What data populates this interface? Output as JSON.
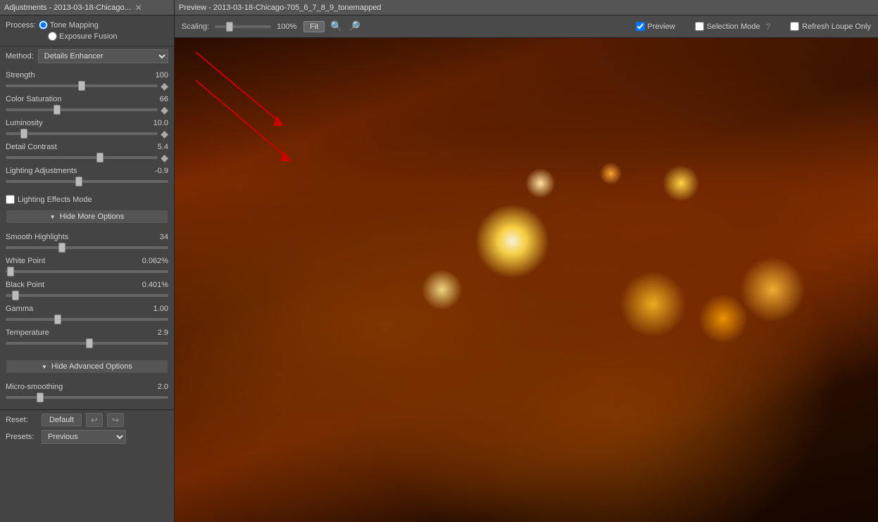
{
  "leftTitle": "Adjustments - 2013-03-18-Chicago...",
  "rightTitle": "Preview - 2013-03-18-Chicago-705_6_7_8_9_tonemapped",
  "process": {
    "label": "Process:",
    "toneMapping": "Tone Mapping",
    "exposureFusion": "Exposure Fusion"
  },
  "method": {
    "label": "Method:",
    "value": "Details Enhancer"
  },
  "scaling": {
    "label": "Scaling:",
    "value": 100,
    "unit": "%"
  },
  "fitButton": "Fit",
  "previewCheck": "Preview",
  "selectionMode": "Selection Mode",
  "refreshLoupeOnly": "Refresh Loupe Only",
  "sliders": {
    "strength": {
      "label": "Strength",
      "value": "100",
      "min": 0,
      "max": 200,
      "current": 100
    },
    "colorSaturation": {
      "label": "Color Saturation",
      "value": "66",
      "min": 0,
      "max": 200,
      "current": 66
    },
    "luminosity": {
      "label": "Luminosity",
      "value": "10.0",
      "min": 0,
      "max": 100,
      "current": 10
    },
    "detailContrast": {
      "label": "Detail Contrast",
      "value": "5.4",
      "min": -20,
      "max": 20,
      "current": 5.4
    },
    "lightingAdjustments": {
      "label": "Lighting Adjustments",
      "value": "-0.9",
      "min": -10,
      "max": 10,
      "current": -0.9
    }
  },
  "lightingEffectsMode": "Lighting Effects Mode",
  "hideMoreOptions": "Hide More Options",
  "moreSliders": {
    "smoothHighlights": {
      "label": "Smooth Highlights",
      "value": "34",
      "min": 0,
      "max": 100,
      "current": 34
    },
    "whitePoint": {
      "label": "White Point",
      "value": "0.062%",
      "min": 0,
      "max": 10,
      "current": 0.062
    },
    "blackPoint": {
      "label": "Black Point",
      "value": "0.401%",
      "min": 0,
      "max": 10,
      "current": 0.401
    },
    "gamma": {
      "label": "Gamma",
      "value": "1.00",
      "min": 0.1,
      "max": 3,
      "current": 1.0
    },
    "temperature": {
      "label": "Temperature",
      "value": "2.9",
      "min": -100,
      "max": 100,
      "current": 2.9
    }
  },
  "hideAdvancedOptions": "Hide Advanced Options",
  "advancedSliders": {
    "microSmoothing": {
      "label": "Micro-smoothing",
      "value": "2.0",
      "min": 0,
      "max": 10,
      "current": 2.0
    }
  },
  "reset": {
    "label": "Reset:",
    "defaultBtn": "Default"
  },
  "presets": {
    "label": "Presets:",
    "value": "Previous"
  },
  "scrollbarIndicator": "▼"
}
